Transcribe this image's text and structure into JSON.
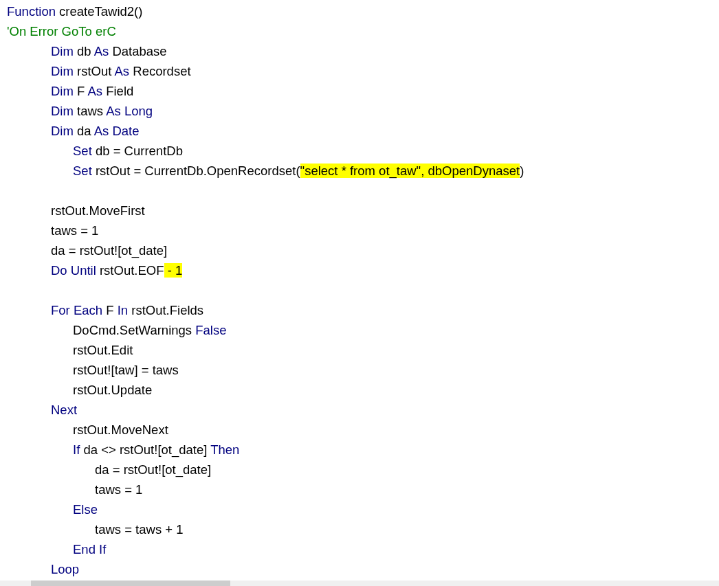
{
  "editor": {
    "lines": [
      {
        "kind": "code",
        "segments": [
          {
            "text": "Function",
            "kind": "keyword"
          },
          {
            "text": " createTawid2()",
            "kind": "plain"
          }
        ]
      },
      {
        "kind": "code",
        "segments": [
          {
            "text": "'On Error GoTo erC",
            "kind": "comment"
          }
        ]
      },
      {
        "kind": "code",
        "segments": [
          {
            "text": "\t\tDim",
            "kind": "keyword"
          },
          {
            "text": " db ",
            "kind": "plain"
          },
          {
            "text": "As",
            "kind": "keyword"
          },
          {
            "text": " Database",
            "kind": "plain"
          }
        ]
      },
      {
        "kind": "code",
        "segments": [
          {
            "text": "\t\tDim",
            "kind": "keyword"
          },
          {
            "text": " rstOut ",
            "kind": "plain"
          },
          {
            "text": "As",
            "kind": "keyword"
          },
          {
            "text": " Recordset",
            "kind": "plain"
          }
        ]
      },
      {
        "kind": "code",
        "segments": [
          {
            "text": "\t\tDim",
            "kind": "keyword"
          },
          {
            "text": " F ",
            "kind": "plain"
          },
          {
            "text": "As",
            "kind": "keyword"
          },
          {
            "text": " Field",
            "kind": "plain"
          }
        ]
      },
      {
        "kind": "code",
        "segments": [
          {
            "text": "\t\tDim",
            "kind": "keyword"
          },
          {
            "text": " taws ",
            "kind": "plain"
          },
          {
            "text": "As Long",
            "kind": "keyword"
          }
        ]
      },
      {
        "kind": "code",
        "segments": [
          {
            "text": "\t\tDim",
            "kind": "keyword"
          },
          {
            "text": " da ",
            "kind": "plain"
          },
          {
            "text": "As Date",
            "kind": "keyword"
          }
        ]
      },
      {
        "kind": "code",
        "segments": [
          {
            "text": "\t\t\tSet",
            "kind": "keyword"
          },
          {
            "text": " db = CurrentDb",
            "kind": "plain"
          }
        ]
      },
      {
        "kind": "code",
        "segments": [
          {
            "text": "\t\t\tSet",
            "kind": "keyword"
          },
          {
            "text": " rstOut = CurrentDb.OpenRecordset(",
            "kind": "plain"
          },
          {
            "text": "\"select * from ot_taw\", dbOpenDynaset",
            "kind": "highlight"
          },
          {
            "text": ")",
            "kind": "plain"
          }
        ]
      },
      {
        "kind": "blank"
      },
      {
        "kind": "code",
        "segments": [
          {
            "text": "\t\trstOut.MoveFirst",
            "kind": "plain"
          }
        ]
      },
      {
        "kind": "code",
        "segments": [
          {
            "text": "\t\ttaws = 1",
            "kind": "plain"
          }
        ]
      },
      {
        "kind": "code",
        "segments": [
          {
            "text": "\t\tda = rstOut![ot_date]",
            "kind": "plain"
          }
        ]
      },
      {
        "kind": "code",
        "segments": [
          {
            "text": "\t\tDo Until",
            "kind": "keyword"
          },
          {
            "text": " rstOut.EOF",
            "kind": "plain"
          },
          {
            "text": " - 1",
            "kind": "highlight"
          }
        ]
      },
      {
        "kind": "blank"
      },
      {
        "kind": "code",
        "segments": [
          {
            "text": "\t\tFor Each",
            "kind": "keyword"
          },
          {
            "text": " F ",
            "kind": "plain"
          },
          {
            "text": "In",
            "kind": "keyword"
          },
          {
            "text": " rstOut.Fields",
            "kind": "plain"
          }
        ]
      },
      {
        "kind": "code",
        "segments": [
          {
            "text": "\t\t\tDoCmd.SetWarnings ",
            "kind": "plain"
          },
          {
            "text": "False",
            "kind": "keyword"
          }
        ]
      },
      {
        "kind": "code",
        "segments": [
          {
            "text": "\t\t\trstOut.Edit",
            "kind": "plain"
          }
        ]
      },
      {
        "kind": "code",
        "segments": [
          {
            "text": "\t\t\trstOut![taw] = taws",
            "kind": "plain"
          }
        ]
      },
      {
        "kind": "code",
        "segments": [
          {
            "text": "\t\t\trstOut.Update",
            "kind": "plain"
          }
        ]
      },
      {
        "kind": "code",
        "segments": [
          {
            "text": "\t\tNext",
            "kind": "keyword"
          }
        ]
      },
      {
        "kind": "code",
        "segments": [
          {
            "text": "\t\t\trstOut.MoveNext",
            "kind": "plain"
          }
        ]
      },
      {
        "kind": "code",
        "segments": [
          {
            "text": "\t\t\tIf",
            "kind": "keyword"
          },
          {
            "text": " da <> rstOut![ot_date] ",
            "kind": "plain"
          },
          {
            "text": "Then",
            "kind": "keyword"
          }
        ]
      },
      {
        "kind": "code",
        "segments": [
          {
            "text": "\t\t\t\tda = rstOut![ot_date]",
            "kind": "plain"
          }
        ]
      },
      {
        "kind": "code",
        "segments": [
          {
            "text": "\t\t\t\ttaws = 1",
            "kind": "plain"
          }
        ]
      },
      {
        "kind": "code",
        "segments": [
          {
            "text": "\t\t\tElse",
            "kind": "keyword"
          }
        ]
      },
      {
        "kind": "code",
        "segments": [
          {
            "text": "\t\t\t\ttaws = taws + 1",
            "kind": "plain"
          }
        ]
      },
      {
        "kind": "code",
        "segments": [
          {
            "text": "\t\t\tEnd If",
            "kind": "keyword"
          }
        ]
      },
      {
        "kind": "code",
        "segments": [
          {
            "text": "\t\tLoop",
            "kind": "keyword"
          }
        ]
      }
    ]
  }
}
